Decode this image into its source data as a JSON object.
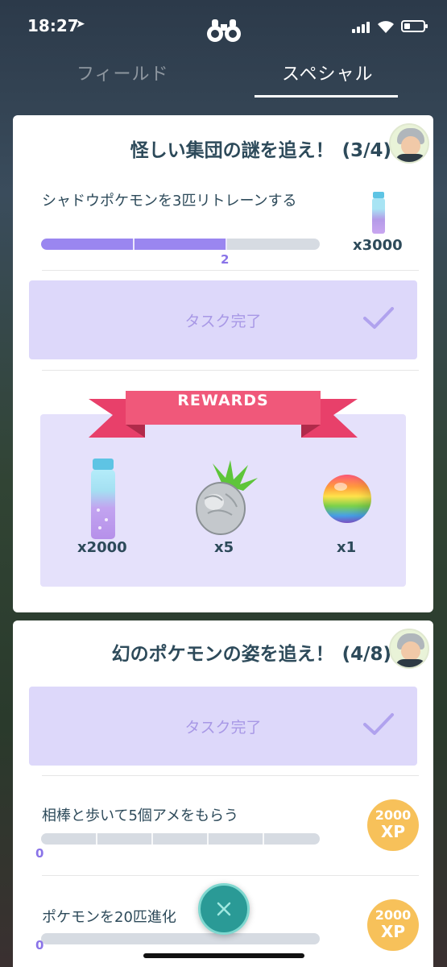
{
  "status_bar": {
    "time": "18:27"
  },
  "tabs": [
    {
      "label": "フィールド",
      "active": false
    },
    {
      "label": "スペシャル",
      "active": true
    }
  ],
  "research": [
    {
      "title": "怪しい集団の謎を追え！",
      "progress": "(3/4)",
      "task": {
        "text": "シャドウポケモンを3匹リトレーンする",
        "progress_value": 2,
        "progress_total": 3,
        "count_label": "2",
        "reward_qty": "x3000",
        "reward_icon": "stardust-potion-icon"
      },
      "complete_label": "タスク完了",
      "rewards_title": "REWARDS",
      "rewards": [
        {
          "icon": "stardust-potion-icon",
          "qty": "x2000"
        },
        {
          "icon": "silver-pinap-berry-icon",
          "qty": "x5"
        },
        {
          "icon": "rare-candy-icon",
          "qty": "x1"
        }
      ]
    },
    {
      "title": "幻のポケモンの姿を追え！",
      "progress": "(4/8)",
      "complete_label": "タスク完了",
      "tasks": [
        {
          "text": "相棒と歩いて5個アメをもらう",
          "count_label": "0",
          "progress_value": 0,
          "progress_total": 5,
          "xp_amount": "2000",
          "xp_unit": "XP"
        },
        {
          "text": "ポケモンを20匹進化",
          "count_label": "0",
          "progress_value": 0,
          "progress_total": 20,
          "xp_amount": "2000",
          "xp_unit": "XP"
        }
      ]
    }
  ],
  "colors": {
    "accent": "#9a86f0",
    "complete_bg": "#ddd8fa",
    "xp": "#f7c15a",
    "ribbon": "#f0587a"
  }
}
